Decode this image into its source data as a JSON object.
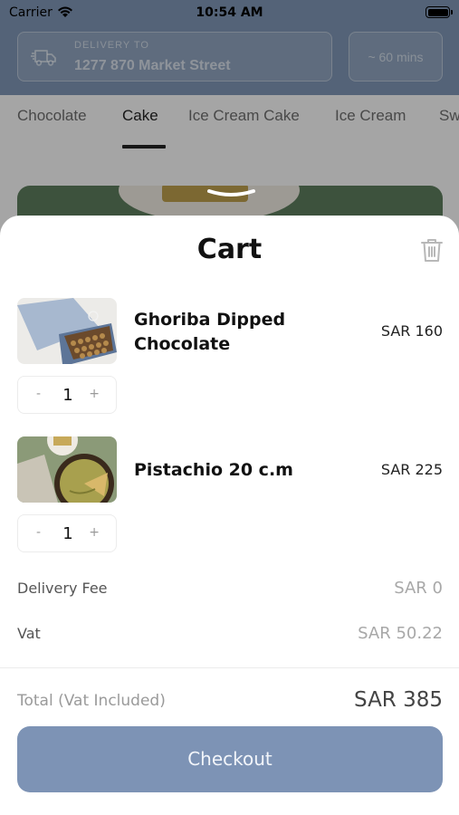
{
  "status_bar": {
    "carrier": "Carrier",
    "time": "10:54 AM"
  },
  "header": {
    "delivery_label": "DELIVERY TO",
    "delivery_address": "1277 870 Market Street",
    "eta": "~ 60 mins"
  },
  "categories": [
    "Chocolate",
    "Cake",
    "Ice Cream Cake",
    "Ice Cream",
    "Sw"
  ],
  "active_category": "Cake",
  "cart": {
    "title": "Cart",
    "items": [
      {
        "name_line1": "Ghoriba Dipped",
        "name_line2": "Chocolate",
        "price": "SAR 160",
        "quantity": "1",
        "minus": "-",
        "plus": "+"
      },
      {
        "name_line1": "Pistachio 20 c.m",
        "price": "SAR 225",
        "quantity": "1",
        "minus": "-",
        "plus": "+"
      }
    ],
    "delivery_fee_label": "Delivery Fee",
    "delivery_fee_value": "SAR 0",
    "vat_label": "Vat",
    "vat_value": "SAR 50.22",
    "total_label": "Total",
    "total_note": "(Vat Included)",
    "total_value": "SAR 385",
    "checkout_label": "Checkout"
  },
  "colors": {
    "accent": "#7d93b5",
    "header": "#7d93b1"
  }
}
